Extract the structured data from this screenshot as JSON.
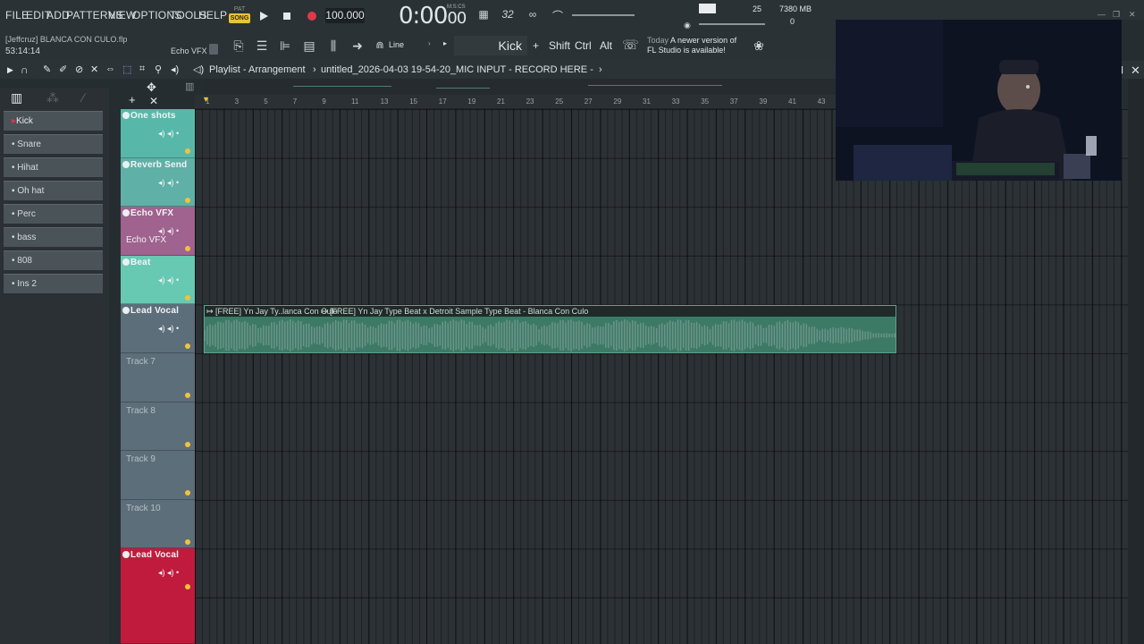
{
  "menu": {
    "items": [
      "FILE",
      "EDIT",
      "ADD",
      "PATTERNS",
      "VIEW",
      "OPTIONS",
      "TOOLS",
      "HELP"
    ],
    "pat_label": "PAT",
    "song_label": "SONG",
    "bpm": "100.000",
    "time": "0:00",
    "time_small": "00",
    "time_unit": "M:S:CS",
    "cpu_value": "25",
    "memory": "7380 MB",
    "voices": "0"
  },
  "toolbar2": {
    "project_title": "[Jeffcruz] BLANCA CON CULO.flp",
    "clock": "53:14:14",
    "hint": "Echo VFX",
    "snap_label": "Line",
    "channel_name": "Kick",
    "plus": "+",
    "shift": "Shift",
    "ctrl": "Ctrl",
    "alt": "Alt",
    "news_today": "Today",
    "news_line1": "A newer version of",
    "news_line2": "FL Studio is available!"
  },
  "playlist": {
    "title": "Playlist - Arrangement",
    "separator": "›",
    "pattern": "untitled_2026-04-03 19-54-20_MIC INPUT - RECORD HERE -",
    "ruler": [
      "1",
      "3",
      "5",
      "7",
      "9",
      "11",
      "13",
      "15",
      "17",
      "19",
      "21",
      "23",
      "25",
      "27",
      "29",
      "31",
      "33",
      "35",
      "37",
      "39",
      "41",
      "43"
    ]
  },
  "picker": {
    "items": [
      "Kick",
      "Snare",
      "Hihat",
      "Oh hat",
      "Perc",
      "bass",
      "808",
      "Ins 2"
    ]
  },
  "tracks": [
    {
      "name": "One shots",
      "color": "#57b8a9"
    },
    {
      "name": "Reverb Send",
      "color": "#5fb0a6"
    },
    {
      "name": "Echo VFX",
      "color": "#a0628e",
      "sub": "Echo VFX"
    },
    {
      "name": "Beat",
      "color": "#68c9b2"
    },
    {
      "name": "Lead Vocal",
      "color": "#5c6e7a"
    },
    {
      "name": "",
      "color": "#5c6e7a",
      "sub": "Track 7"
    },
    {
      "name": "",
      "color": "#5c6e7a",
      "sub": "Track 8"
    },
    {
      "name": "",
      "color": "#5c6e7a",
      "sub": "Track 9"
    },
    {
      "name": "",
      "color": "#5c6e7a",
      "sub": "Track 10"
    },
    {
      "name": "Lead Vocal",
      "color": "#c01b3c"
    }
  ],
  "clip": {
    "title1": "[FREE] Yn Jay Ty..lanca Con Culo",
    "title2": "[FREE] Yn Jay Type Beat x Detroit Sample Type Beat - Blanca Con Culo"
  },
  "colors": {
    "accent": "#e7c33d",
    "record": "#e0384a",
    "clip": "#3d7a66"
  }
}
